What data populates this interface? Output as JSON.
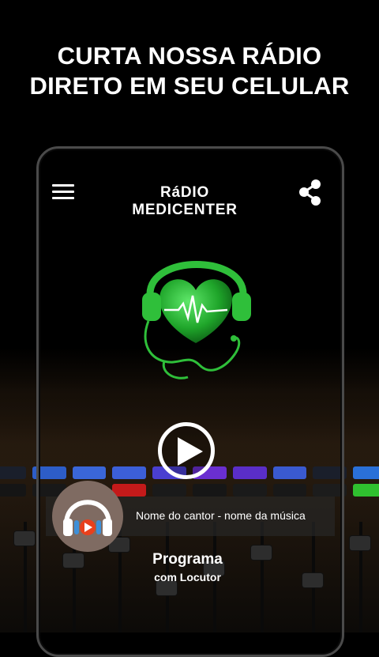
{
  "promo": {
    "headline_line1": "CURTA NOSSA RÁDIO",
    "headline_line2": "DIRETO EM SEU CELULAR"
  },
  "app": {
    "title": "RáDIO MEDICENTER",
    "menu_icon": "hamburger-menu-icon",
    "share_icon": "share-icon",
    "logo": "green-heart-headphones-logo"
  },
  "player": {
    "play_icon": "play-icon",
    "now_playing": "Nome do cantor - nome da música",
    "program_name": "Programa",
    "program_host": "com Locutor",
    "avatar_icon": "headphones-play-avatar-icon"
  },
  "colors": {
    "background": "#000000",
    "text": "#ffffff",
    "logo_green": "#2fbf3a",
    "avatar_bg": "#7f6b62",
    "avatar_accent": "#e8401c",
    "avatar_headphones": "#3d8fd8"
  }
}
